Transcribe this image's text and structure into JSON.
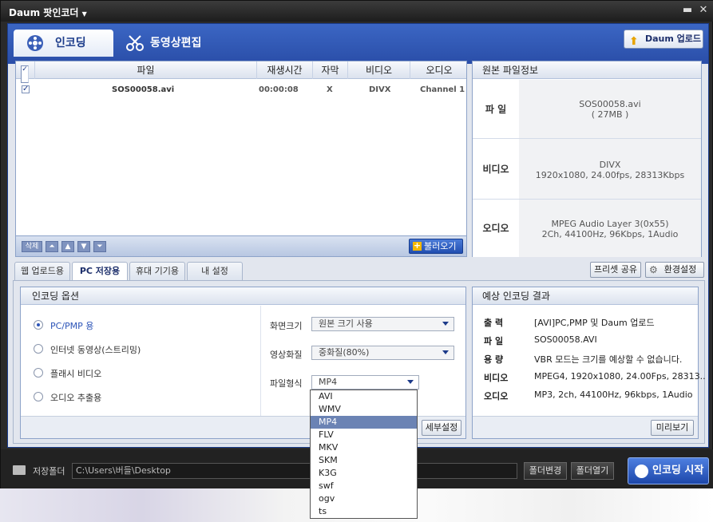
{
  "window": {
    "title": "Daum 팟인코더",
    "title_arrow": "▼",
    "min_glyph": "▬",
    "close_glyph": "✕"
  },
  "main_tabs": [
    {
      "label": "인코딩",
      "active": true
    },
    {
      "label": "동영상편집",
      "active": false
    }
  ],
  "daum_upload_label": "Daum 업로드",
  "file_list": {
    "columns": [
      "파일",
      "재생시간",
      "자막",
      "비디오",
      "오디오"
    ],
    "rows": [
      {
        "checked": true,
        "file": "SOS00058.avi",
        "duration": "00:00:08",
        "subtitle": "X",
        "video": "DIVX",
        "audio": "Channel 1"
      }
    ],
    "delete_label": "삭제",
    "load_label": "불러오기"
  },
  "source_info": {
    "title": "원본 파일정보",
    "rows": [
      {
        "label": "파 일",
        "line1": "SOS00058.avi",
        "line2": "( 27MB )"
      },
      {
        "label": "비디오",
        "line1": "DIVX",
        "line2": "1920x1080, 24.00fps, 28313Kbps"
      },
      {
        "label": "오디오",
        "line1": "MPEG Audio Layer 3(0x55)",
        "line2": "2Ch, 44100Hz, 96Kbps, 1Audio"
      }
    ]
  },
  "sub_tabs": [
    {
      "label": "웹 업로드용",
      "active": false
    },
    {
      "label": "PC 저장용",
      "active": true
    },
    {
      "label": "휴대 기기용",
      "active": false
    },
    {
      "label": "내 설정",
      "active": false
    }
  ],
  "preset_share_label": "프리셋 공유",
  "settings_label": "환경설정",
  "encoding_options": {
    "title": "인코딩 옵션",
    "radios": [
      {
        "label": "PC/PMP 용",
        "checked": true
      },
      {
        "label": "인터넷 동영상(스트리밍)",
        "checked": false
      },
      {
        "label": "플래시 비디오",
        "checked": false
      },
      {
        "label": "오디오 추출용",
        "checked": false
      }
    ],
    "screen_size_label": "화면크기",
    "screen_size_value": "원본 크기 사용",
    "quality_label": "영상화질",
    "quality_value": "중화질(80%)",
    "format_label": "파일형식",
    "format_value": "MP4",
    "detail_label": "세부설정"
  },
  "format_dropdown": {
    "options": [
      "AVI",
      "WMV",
      "MP4",
      "FLV",
      "MKV",
      "SKM",
      "K3G",
      "swf",
      "ogv",
      "ts"
    ],
    "selected": "MP4"
  },
  "expected_result": {
    "title": "예상 인코딩 결과",
    "rows": [
      {
        "label": "출 력",
        "value": "[AVI]PC,PMP 및 Daum 업로드"
      },
      {
        "label": "파 일",
        "value": "SOS00058.AVI"
      },
      {
        "label": "용 량",
        "value": "VBR 모드는 크기를 예상할 수 없습니다."
      },
      {
        "label": "비디오",
        "value": "MPEG4, 1920x1080, 24.00Fps, 28313.."
      },
      {
        "label": "오디오",
        "value": "MP3, 2ch, 44100Hz, 96kbps, 1Audio"
      }
    ],
    "preview_label": "미리보기"
  },
  "bottom": {
    "folder_label": "저장폴더",
    "path_value": "C:\\Users\\버들\\Desktop",
    "change_folder_label": "폴더변경",
    "open_folder_label": "폴더열기",
    "start_label": "인코딩 시작"
  },
  "colors": {
    "accent_blue": "#2a4ea8",
    "title_bar": "#1d1d1d",
    "selected_item": "#6b83b4"
  }
}
